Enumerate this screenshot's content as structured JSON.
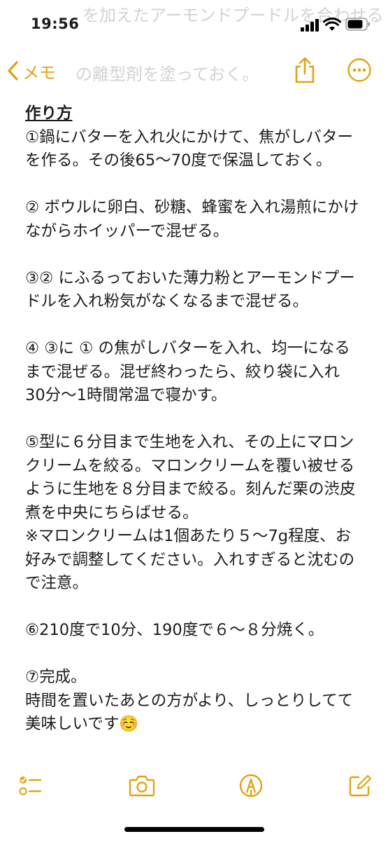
{
  "status_bar": {
    "time": "19:56"
  },
  "background_text": {
    "line1": "を加えたアーモンドプードルを合わせる",
    "line2": "の離型剤を塗っておく。"
  },
  "nav": {
    "back_label": "メモ"
  },
  "note": {
    "title": "作り方",
    "paragraphs": [
      [
        "①鍋にバターを入れ火にかけて、焦がしバター",
        "を作る。その後65～70度で保温しておく。"
      ],
      [
        "② ボウルに卵白、砂糖、蜂蜜を入れ湯煎にかけ",
        "ながらホイッパーで混ぜる。"
      ],
      [
        "③② にふるっておいた薄力粉とアーモンドプー",
        "ドルを入れ粉気がなくなるまで混ぜる。"
      ],
      [
        "④ ③に ① の焦がしバターを入れ、均一になる",
        "まで混ぜる。混ぜ終わったら、絞り袋に入れ",
        "30分～1時間常温で寝かす。"
      ],
      [
        "⑤型に６分目まで生地を入れ、その上にマロン",
        "クリームを絞る。マロンクリームを覆い被せる",
        "ように生地を８分目まで絞る。刻んだ栗の渋皮",
        "煮を中央にちらばせる。",
        "※マロンクリームは1個あたり５～7g程度、お",
        "好みで調整してください。入れすぎると沈むの",
        "で注意。"
      ],
      [
        "⑥210度で10分、190度で６～８分焼く。"
      ],
      [
        "⑦完成。",
        "時間を置いたあとの方がより、しっとりしてて",
        "美味しいです☺️"
      ]
    ]
  },
  "colors": {
    "accent": "#e3a214",
    "text": "#1c1c1e",
    "ghost": "#d3d3d3"
  },
  "icons": {
    "status": [
      "signal-icon",
      "wifi-icon",
      "battery-icon"
    ],
    "nav": [
      "chevron-left-icon",
      "share-icon",
      "more-icon"
    ],
    "toolbar": [
      "checklist-icon",
      "camera-icon",
      "markup-icon",
      "compose-icon"
    ]
  }
}
